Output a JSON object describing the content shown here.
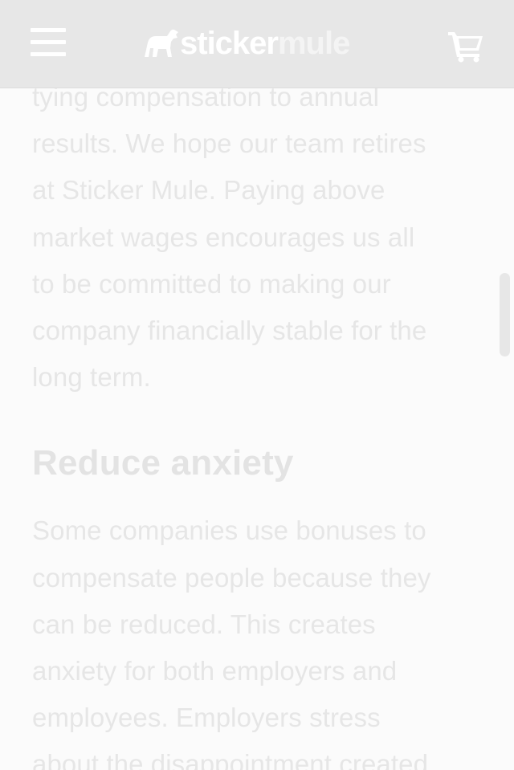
{
  "header": {
    "brand_left": "sticker",
    "brand_right": "mule"
  },
  "article": {
    "paragraph1_lines": [
      "tying compensation to annual",
      "results. We hope our team retires",
      "at Sticker Mule. Paying above",
      "market wages encourages us all",
      "to be committed to making our",
      "company financially stable for the",
      "long term."
    ],
    "heading": "Reduce anxiety",
    "paragraph2_lines": [
      "Some companies use bonuses to",
      "compensate people because they",
      "can be reduced. This creates",
      "anxiety for both employers and",
      "employees. Employers stress",
      "about the disappointment created"
    ]
  },
  "icons": {
    "menu": "hamburger-menu-icon",
    "logo": "mule-logo-icon",
    "cart": "shopping-cart-icon"
  },
  "colors": {
    "header_bg": "#e7e7e7",
    "page_bg": "#fbfbfb",
    "text": "#e6e6e6",
    "icon": "#ffffff"
  }
}
